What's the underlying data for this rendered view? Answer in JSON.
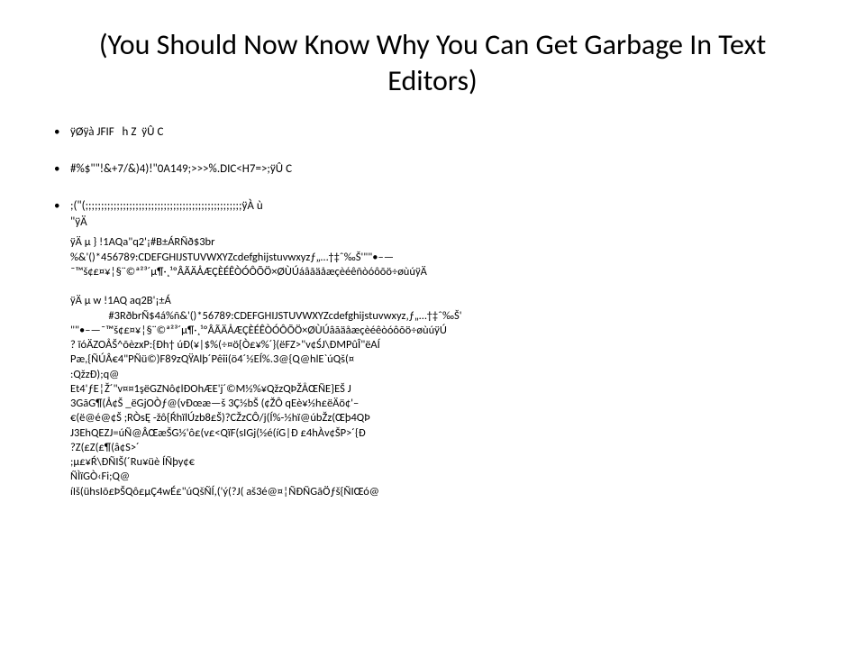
{
  "slide": {
    "title": "(You Should Now Know Why You Can Get Garbage In Text Editors)",
    "bullets": [
      "ÿØÿà \u0010JFIF \u0001\u0001 \u0001 h Z  ÿÛ C \u0001\u0001\u0001\u0001\u0001\u0001\n\u0001\u0001\u0001\u0001\u0001",
      "\u0001\u0001\u0001\u0001\u0001\u0001\u0001#\u0001\u0001%$\"\u0001\"!&+7/&)4)!\"0A149;>>>%.DIC<H7=>;ÿÛ C \u0001\n\u0001\u0001",
      "\u0001\u0001\u0001\u0001\u0001\u0001;(\"(;;;;;;;;;;;;;;;;;;;;;;;;;;;;;;;;;;;;;;;;;;;;;;;;;;ÿÀ \u0001\u0001\u0001\u0001ù\n\u0001\u0001\u0001\"\u0001\u0001\u0001\u0001\u0001\u0001\u0001\u0001ÿÄ \u0001\u0001\u0001\u0001\u0001\u0001\u0001\u0001\u0001\u0001\u0001\u0001\u0001\u0001\u0001\u0001\u0001\u0001\u0001\u0001"
    ],
    "body": "ÿÄ µ \u0001\u0001\u0001\u0001\u0001\u0001\u0001\u0001\u0001\u0001\u0001\u0001\u0001\u0001\u0001} \u0001\u0001\u0001\u0001\u0001\u0001!1A\u0001\u0001Qa\u0001\"q\u00012\u0001'¡\u0001#B±Á\u0001RÑð$3br\u0001\n\u0001\u0001\u0001\u0001\u0001\u0001\u0001\u0001%&'()*456789:CDEFGHIJSTUVWXYZcdefghijstuvwxyzƒ„…†‡ˆ‰Š'\"\"•–—\n˜™š¢£¤¥¦§¨©ª²³´µ¶·¸¹ºÂÃÄÅÆÇÈÉÊÒÓÔÕÖ×ØÙÚáâãäåæçèéêñòóôõö÷øùúÿÄ \u0001\u0001\u0001\n\u0001\u0001\u0001\u0001\u0001\u0001\u0001\u0001\u0001\u0001\u0001\u0001\u0001\u0001\u0001\u0001\u0001\u0001\u0001\u0001\u0001\u0001\u0001\u0001\u0001\u0001\nÿÄ µ \u0001\u0001\u0001\u0001\u0001\u0001\u0001\u0001\u0001\u0001\u0001\u0001\u0001w \u0001\u0001\u0001\u0001\u0001\u0001!1\u0001\u0001AQ aq\u0001\u00012\u0001\u0001\u0001B'¡±Á\n               #3Rð\u0001brÑ\u0001$4á%ñ\u0001\u0001\u0001\u0001\u0001&'()*56789:CDEFGHIJSTUVWXYZcdefghijstuvwxyz‚ƒ„…†‡ˆ‰Š'\n\"\"•–—˜™š¢£¤¥¦§¨©ª²³´µ¶·¸¹ºÂÃÄÅÆÇÈÉÊÒÓÔÕÖ×ØÙÚâãäåæçèéêòóôõö÷øùúÿÚ\n\u0001\u0001\u0001\u0001\u0001\u0001\u0001\u0001\u0001? ïóÄ\u0001ZOÅŠ^õèzxP:{Ðh\u0001† úÐ(¥|$%(÷¤ö{Ò\u0001£¥%\u0001´}(ëF\u0001Z>\"v¢ŚJ\\ÐM\u0001P\u0001û\u0001Î\"ëAÍ\nP\u0001æ,{ÑÚ\u0001Â€\u00014\"P\u0001Ñü©)F8\u00019\u0001zQŸAl\u0001þ´P\u0001êîi(ö4´½\u0001E\u0001Í%.3@\u0001\u0001{Q@\u0001hl\u0001\u0001E\u0001`úQš(¤\n:QžzÐ);q@\nE\u0001t4\u0001'ƒE¦\u0001Ž´\u0001\"v¤¤1şëGZNô¢\u0001lÐO\u0001hÆE'j\u0001\u0001´\u0001©M\u0001\u0001\u0001½%\u0001¥\u0001\u0001QžzQÞŽÅ\u0001ŒÑE\u0001}E\u0001Š J\n3GãG¶(Å\u0001\u0001\u0001\u0001\u0001\u0001\u0001¢Š _ëGjOÒƒ@(\u0001vÐ\u0001\u0001\u0001œæ—š 3Ç½\u0001bŠ (¢ŽÔ qE\u0001è\u0001¥\u0001\u0001½h£ëÄ\u0001ö¢'–\n€\u0001(ë@é@\u0001\u0001\u0001¢Š ;RÒsĘ -\u0001žô{Ŕ\u0001hïlÚ\u0001zb\u00018£Š)?C\u0001ŽzCÔ/j(Í%-\u0001\u0001½hï@úbŽz\u0001\u0001\u0001(\u0001Œþ4QÞ\u0001\nJ3E\u0001h\u0001QE\u0001\u0001ZJ=úÑ@ÂŒæŠ\u0001G½'ô£\u0001(\u0001v£\u0001<QïF(\u0001sIGj(\u0001\u0001½é(íG|Ð £4\u0001hÀ\u0001v¢Š\u0001\u0001\u0001P>´{Ð\n?Z(£\u0001Z\u0001\u0001(£¶(â\u0001\u0001¢S>´\n;µ£¥\u0001Ŕ\\Ð\u0001ÑI\u0001Š(\u0001´Ru¥üè Í\u0001Ñþy¢€\nÑÌïGÒ\u0001‹Fi;Q@\níIš(üh\u0001sIõ£ÞŠ\u0001\u0001\u0001Qô£µ\u0001Ç4wÉ£\"úQš\u0001\u0001\u0001ÑÍ\u0001,('ý(?J( aš3é@¤¦\u0001ÑÐÑGãÖ\u0001ƒš\u0001{ÑIŒó@"
  }
}
